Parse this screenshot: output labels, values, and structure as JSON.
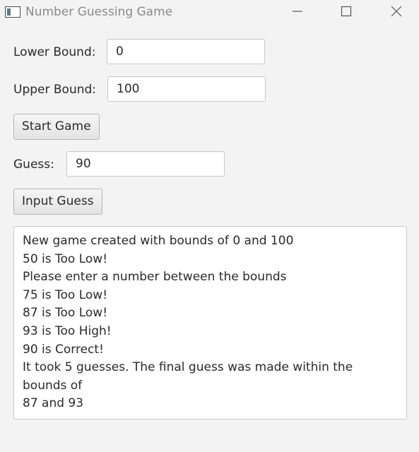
{
  "window": {
    "title": "Number Guessing Game",
    "icons": {
      "app": "app-window-icon",
      "minimize": "minimize-icon",
      "maximize": "maximize-icon",
      "close": "close-icon"
    }
  },
  "form": {
    "lower_label": "Lower Bound:",
    "lower_value": "0",
    "upper_label": "Upper Bound:",
    "upper_value": "100",
    "start_button": "Start Game",
    "guess_label": "Guess:",
    "guess_value": "90",
    "input_button": "Input Guess"
  },
  "output": {
    "lines": [
      "New game created with bounds of 0 and 100",
      "50 is Too Low!",
      "Please enter a number between the bounds",
      "75 is Too Low!",
      "87 is Too Low!",
      "93 is Too High!",
      "90 is Correct!",
      "It took 5 guesses. The final guess was made within the bounds of",
      "87 and 93"
    ]
  },
  "colors": {
    "background": "#f3f3f3",
    "field_border": "#c8c8c8",
    "title_text": "#8a8a8a"
  }
}
